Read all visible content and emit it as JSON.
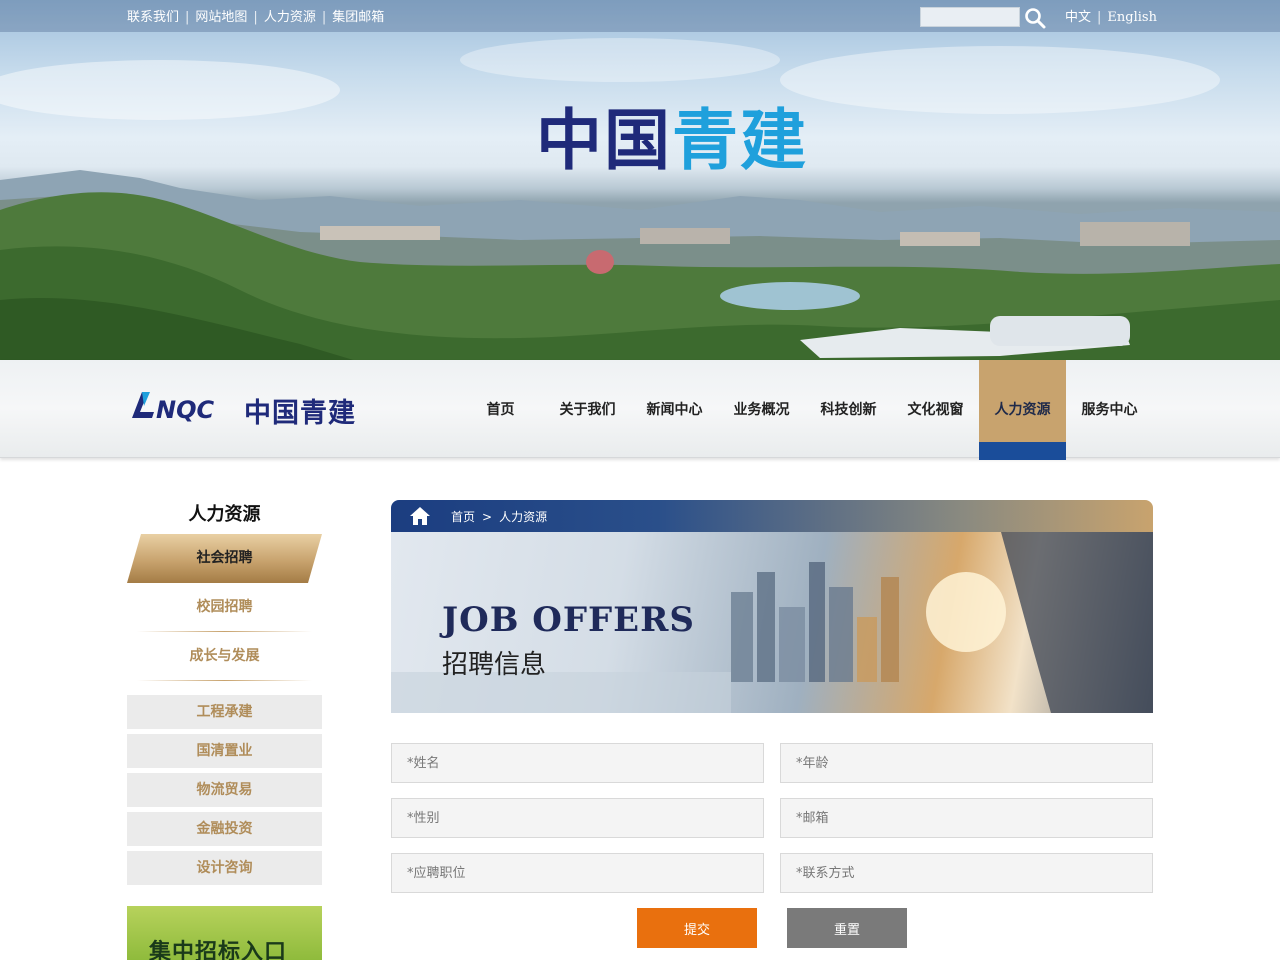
{
  "topbar": {
    "links": [
      "联系我们",
      "网站地图",
      "人力资源",
      "集团邮箱"
    ],
    "separator": "|",
    "lang_zh": "中文",
    "lang_en": "English"
  },
  "hero": {
    "title_part1": "中国",
    "title_part2": "青建"
  },
  "brand": {
    "logo_name": "cnqc-logo",
    "logo_text": "中国青建"
  },
  "nav": {
    "items": [
      "首页",
      "关于我们",
      "新闻中心",
      "业务概况",
      "科技创新",
      "文化视窗",
      "人力资源",
      "服务中心"
    ],
    "active_index": 6
  },
  "sidebar": {
    "title": "人力资源",
    "active_item": "社会招聘",
    "links": [
      "校园招聘",
      "成长与发展"
    ],
    "boxes": [
      "工程承建",
      "国清置业",
      "物流贸易",
      "金融投资",
      "设计咨询"
    ],
    "banner_text": "集中招标入口"
  },
  "breadcrumb": {
    "home": "首页",
    "separator": ">",
    "current": "人力资源"
  },
  "job_banner": {
    "title_en": "JOB OFFERS",
    "title_zh": "招聘信息"
  },
  "form": {
    "name_placeholder": "*姓名",
    "age_placeholder": "*年龄",
    "gender_placeholder": "*性别",
    "email_placeholder": "*邮箱",
    "position_placeholder": "*应聘职位",
    "contact_placeholder": "*联系方式",
    "submit_label": "提交",
    "reset_label": "重置"
  },
  "colors": {
    "brand_navy": "#1f2a7a",
    "brand_blue": "#1fa0dc",
    "gold": "#c8a36e",
    "active_underline": "#1a4d9a",
    "submit": "#e9700e",
    "reset": "#7a7a7a"
  }
}
